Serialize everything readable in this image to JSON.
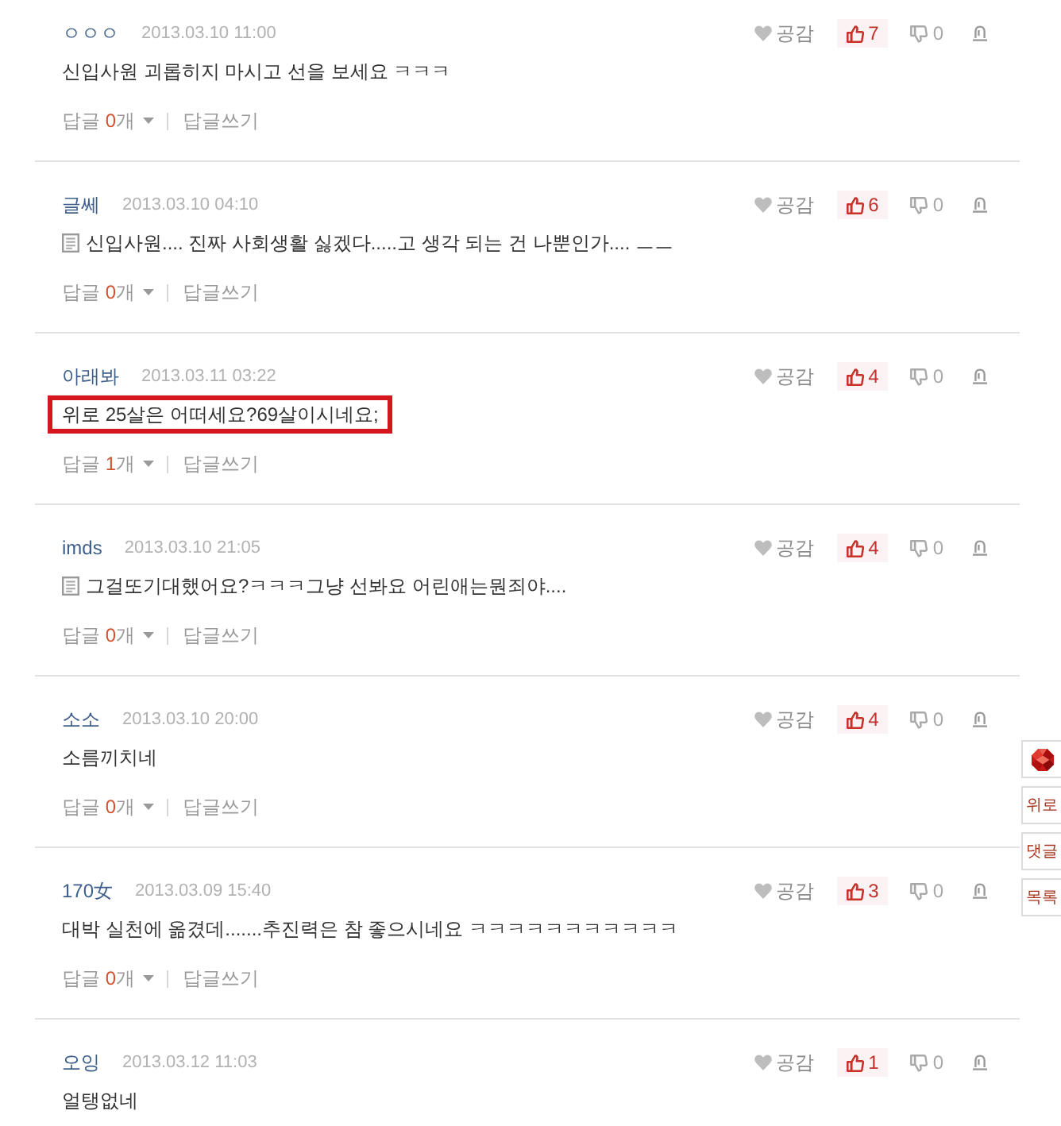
{
  "comments": [
    {
      "author": "ㅇㅇㅇ",
      "date": "2013.03.10 11:00",
      "empathy_label": "공감",
      "likes": "7",
      "dislikes": "0",
      "has_note": false,
      "highlighted": false,
      "text": "신입사원 괴롭히지 마시고 선을 보세요 ㅋㅋㅋ",
      "replies": {
        "label": "답글",
        "count": "0",
        "unit": "개",
        "write": "답글쓰기"
      }
    },
    {
      "author": "글쎄",
      "date": "2013.03.10 04:10",
      "empathy_label": "공감",
      "likes": "6",
      "dislikes": "0",
      "has_note": true,
      "highlighted": false,
      "text": "신입사원.... 진짜 사회생활 싫겠다.....고 생각 되는 건 나뿐인가.... ㅡㅡ",
      "replies": {
        "label": "답글",
        "count": "0",
        "unit": "개",
        "write": "답글쓰기"
      }
    },
    {
      "author": "아래봐",
      "date": "2013.03.11 03:22",
      "empathy_label": "공감",
      "likes": "4",
      "dislikes": "0",
      "has_note": false,
      "highlighted": true,
      "text": "위로 25살은 어떠세요?69살이시네요;",
      "replies": {
        "label": "답글",
        "count": "1",
        "unit": "개",
        "write": "답글쓰기"
      }
    },
    {
      "author": "imds",
      "date": "2013.03.10 21:05",
      "empathy_label": "공감",
      "likes": "4",
      "dislikes": "0",
      "has_note": true,
      "highlighted": false,
      "text": "그걸또기대했어요?ㅋㅋㅋ그냥 선봐요 어린애는뭔죄야....",
      "replies": {
        "label": "답글",
        "count": "0",
        "unit": "개",
        "write": "답글쓰기"
      }
    },
    {
      "author": "소소",
      "date": "2013.03.10 20:00",
      "empathy_label": "공감",
      "likes": "4",
      "dislikes": "0",
      "has_note": false,
      "highlighted": false,
      "text": "소름끼치네",
      "replies": {
        "label": "답글",
        "count": "0",
        "unit": "개",
        "write": "답글쓰기"
      }
    },
    {
      "author": "170女",
      "date": "2013.03.09 15:40",
      "empathy_label": "공감",
      "likes": "3",
      "dislikes": "0",
      "has_note": false,
      "highlighted": false,
      "text": "대박 실천에 옮겼데.......추진력은 참 좋으시네요 ㅋㅋㅋㅋㅋㅋㅋㅋㅋㅋㅋ",
      "replies": {
        "label": "답글",
        "count": "0",
        "unit": "개",
        "write": "답글쓰기"
      }
    },
    {
      "author": "오잉",
      "date": "2013.03.12 11:03",
      "empathy_label": "공감",
      "likes": "1",
      "dislikes": "0",
      "has_note": false,
      "highlighted": false,
      "text": "얼탱없네"
    }
  ],
  "side_menu": {
    "labels": [
      "위로",
      "댓글",
      "목록"
    ]
  }
}
